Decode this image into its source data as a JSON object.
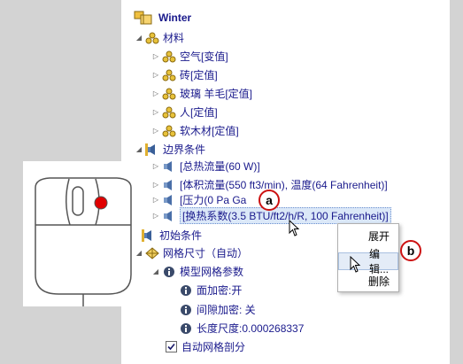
{
  "tree": {
    "root": "Winter",
    "materials": {
      "label": "材料",
      "items": [
        "空气[变值]",
        "砖[定值]",
        "玻璃 羊毛[定值]",
        "人[定值]",
        "软木材[定值]"
      ]
    },
    "boundary": {
      "label": "边界条件",
      "items": [
        "[总热流量(60 W)]",
        "[体积流量(550 ft3/min), 温度(64 Fahrenheit)]",
        "[压力(0 Pa Ga",
        "[换热系数(3.5 BTU/ft2/h/R, 100 Fahrenheit)]"
      ]
    },
    "initial": "初始条件",
    "mesh": {
      "label": "网格尺寸（自动）",
      "model_params": "模型网格参数",
      "surface_refine": "面加密:开",
      "gap_refine": "间隙加密: 关",
      "length_scale": "长度尺度:0.000268337",
      "auto_mesh": "自动网格剖分"
    }
  },
  "context_menu": {
    "items": [
      "展开",
      "编辑...",
      "删除"
    ]
  },
  "callouts": {
    "a": "a",
    "b": "b"
  }
}
